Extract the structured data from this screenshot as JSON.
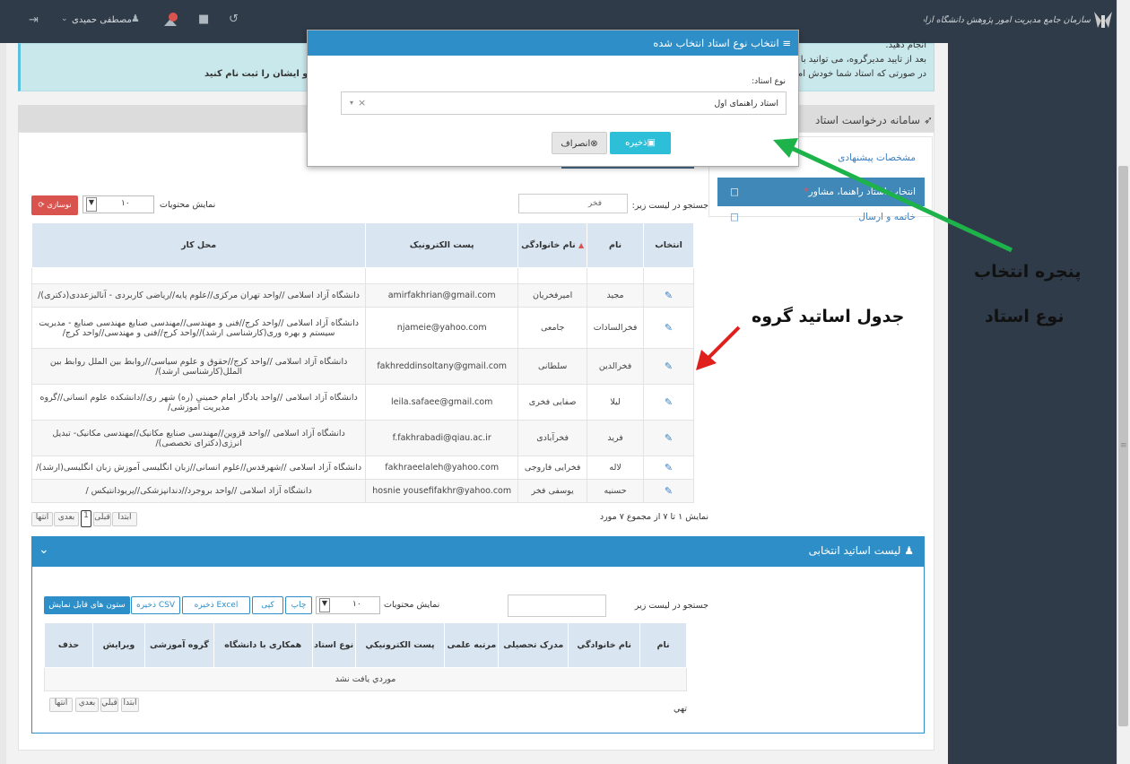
{
  "topbar": {
    "brand": "سازمان جامع مدیریت امور پژوهش دانشگاه آزاد اسلامی (پژوهشیار)",
    "user_name": "مصطفی حمیدی"
  },
  "notice": {
    "line1": "انجام دهید.",
    "line2": "بعد از تایید مدیرگروه، می توانید با",
    "line3": "در صورتی که استاد شما خودش ام",
    "line_left": "ید و ایشان را ثبت نام کنید"
  },
  "side_panel": {
    "title": "سامانه درخواست استاد",
    "items": [
      {
        "label": "مشخصات پیشنهادی"
      },
      {
        "label": "انتخاب استاد راهنما، مشاور",
        "marker": "*"
      },
      {
        "label": "خاتمه و ارسال"
      }
    ]
  },
  "modal": {
    "title": "انتخاب نوع استاد انتخاب شده",
    "field_label": "نوع استاد:",
    "select_value": "استاد راهنمای اول",
    "clear_glyph": "×",
    "save_label": "ذخیره",
    "cancel_label": "انصراف"
  },
  "group_table": {
    "search_label": "جستجو در لیست زیر:",
    "search_value": "فخر",
    "page_size_label": "نمایش محتویات",
    "page_size": "۱۰",
    "refresh_label": "نوسازی",
    "headers": [
      "انتخاب",
      "نام",
      "نام خانوادگی",
      "پست الکترونیک",
      "محل کار"
    ],
    "rows": [
      {
        "first": "مجید",
        "last": "امیرفخریان",
        "email": "amirfakhrian@gmail.com",
        "work": "دانشگاه آزاد اسلامی //واحد تهران مرکزی//علوم پایه//ریاضی کاربردی - آنالیزعددی(دکتری)/"
      },
      {
        "first": "فخرالسادات",
        "last": "جامعی",
        "email": "njameie@yahoo.com",
        "work": "دانشگاه آزاد اسلامی //واحد کرج//فنی و مهندسی//مهندسی صنایع مهندسی صنایع - مدیریت سیستم و بهره وری(کارشناسی ارشد)//واحد کرج//فنی و مهندسی//واحد کرج/"
      },
      {
        "first": "فخرالدین",
        "last": "سلطانی",
        "email": "fakhreddinsoltany@gmail.com",
        "work": "دانشگاه آزاد اسلامی //واحد کرج//حقوق و علوم سیاسی//روابط بین الملل روابط بین الملل(کارشناسی ارشد)/"
      },
      {
        "first": "لیلا",
        "last": "صفایی فخری",
        "email": "leila.safaee@gmail.com",
        "work": "دانشگاه آزاد اسلامی //واحد یادگار امام خمینی (ره) شهر ری//دانشکده علوم انسانی//گروه مدیریت آموزشی/"
      },
      {
        "first": "فرید",
        "last": "فخرآبادی",
        "email": "f.fakhrabadi@qiau.ac.ir",
        "work": "دانشگاه آزاد اسلامی //واحد قزوین//مهندسی صنایع مکانیک//مهندسی مکانیک- تبدیل انرژی(دکترای تخصصی)/"
      },
      {
        "first": "لاله",
        "last": "فخرایی فاروجی",
        "email": "fakhraeelaleh@yahoo.com",
        "work": "دانشگاه آزاد اسلامی //شهرقدس//علوم انسانی//زبان انگلیسی آموزش زبان انگلیسی(ارشد)/"
      },
      {
        "first": "حسنیه",
        "last": "یوسفی فخر",
        "email": "hosnie yousefifakhr@yahoo.com",
        "work": "دانشگاه آزاد اسلامی //واحد بروجرد//دندانپزشکی//پریودانتیکس /"
      }
    ],
    "summary": "نمایش ۱ تا ۷ از مجموع ۷ مورد",
    "pager": [
      "ابتدا",
      "قبلی",
      "1",
      "بعدی",
      "انتها"
    ]
  },
  "selected_list": {
    "title": "لیست اساتید انتخابی",
    "search_label": "جستجو در لیست زیر",
    "page_size_label": "نمایش محتویات",
    "page_size": "۱۰",
    "buttons": [
      "ستون های قابل نمایش",
      "ذخیره CSV",
      "ذخیره Excel",
      "کپی",
      "چاپ"
    ],
    "headers": [
      "نام",
      "نام خانوادگي",
      "مدرک تحصیلی",
      "مرتبه علمی",
      "پست الکترونيکي",
      "نوع استاد",
      "همکاری با دانشگاه",
      "گروه آموزشی",
      "ویرایش",
      "حذف"
    ],
    "empty_text": "موردي يافت نشد",
    "summary": "تهي",
    "pager": [
      "ابتدا",
      "قبلي",
      "بعدي",
      "انتها"
    ]
  },
  "annotations": {
    "modal_label_1": "پنجره انتخاب",
    "modal_label_2": "نوع استاد",
    "table_label": "جدول اساتید گروه"
  },
  "colors": {
    "topbar": "#2f3b48",
    "primary": "#2e8fc8",
    "danger": "#d9534f",
    "arrow_green": "#1db34a",
    "arrow_red": "#e0201c"
  }
}
